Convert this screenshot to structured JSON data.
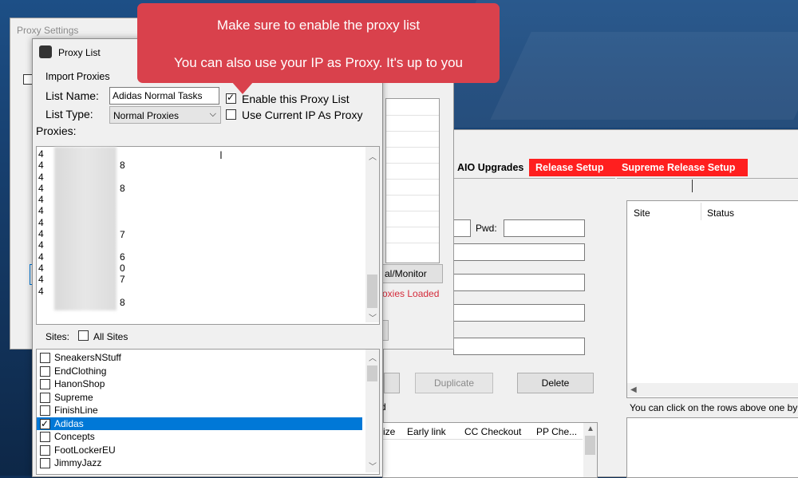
{
  "callout": {
    "line1": "Make sure to enable the proxy list",
    "line2": "You can also use your IP as Proxy. It's up to you"
  },
  "settings_window": {
    "title": "Proxy Settings",
    "button_partial": "al/Monitor",
    "loaded_text": "oxies Loaded"
  },
  "proxy_list": {
    "title": "Proxy List",
    "group_label": "Import Proxies",
    "list_name_label": "List Name:",
    "list_name_value": "Adidas Normal Tasks",
    "list_type_label": "List Type:",
    "list_type_value": "Normal Proxies",
    "enable_label": "Enable this Proxy List",
    "enable_checked": true,
    "use_ip_label": "Use Current IP As Proxy",
    "use_ip_checked": false,
    "proxies_label": "Proxies:",
    "proxy_prefixes": [
      "4",
      "4",
      "4",
      "4",
      "4",
      "4",
      "4",
      "4",
      "4",
      "4",
      "4",
      "4",
      "4"
    ],
    "proxy_suffixes": [
      "8",
      "8",
      "7",
      "6",
      "0",
      "7",
      "8"
    ],
    "sites_label": "Sites:",
    "all_sites_label": "All Sites",
    "sites": [
      {
        "name": "SneakersNStuff",
        "checked": false
      },
      {
        "name": "EndClothing",
        "checked": false
      },
      {
        "name": "HanonShop",
        "checked": false
      },
      {
        "name": "Supreme",
        "checked": false
      },
      {
        "name": "FinishLine",
        "checked": false
      },
      {
        "name": "Adidas",
        "checked": true
      },
      {
        "name": "Concepts",
        "checked": false
      },
      {
        "name": "FootLockerEU",
        "checked": false
      },
      {
        "name": "JimmyJazz",
        "checked": false
      }
    ]
  },
  "main_window": {
    "tabs": [
      "AIO Upgrades",
      "Release Setup",
      "Supreme Release Setup"
    ],
    "pwd_label": "Pwd:",
    "duplicate_label": "Duplicate",
    "delete_label": "Delete",
    "stub_d": "d",
    "columns": [
      "ize",
      "Early link",
      "CC Checkout",
      "PP Che..."
    ],
    "right_columns": [
      "Site",
      "Status"
    ],
    "hint_text": "You can click on the rows above one by"
  }
}
